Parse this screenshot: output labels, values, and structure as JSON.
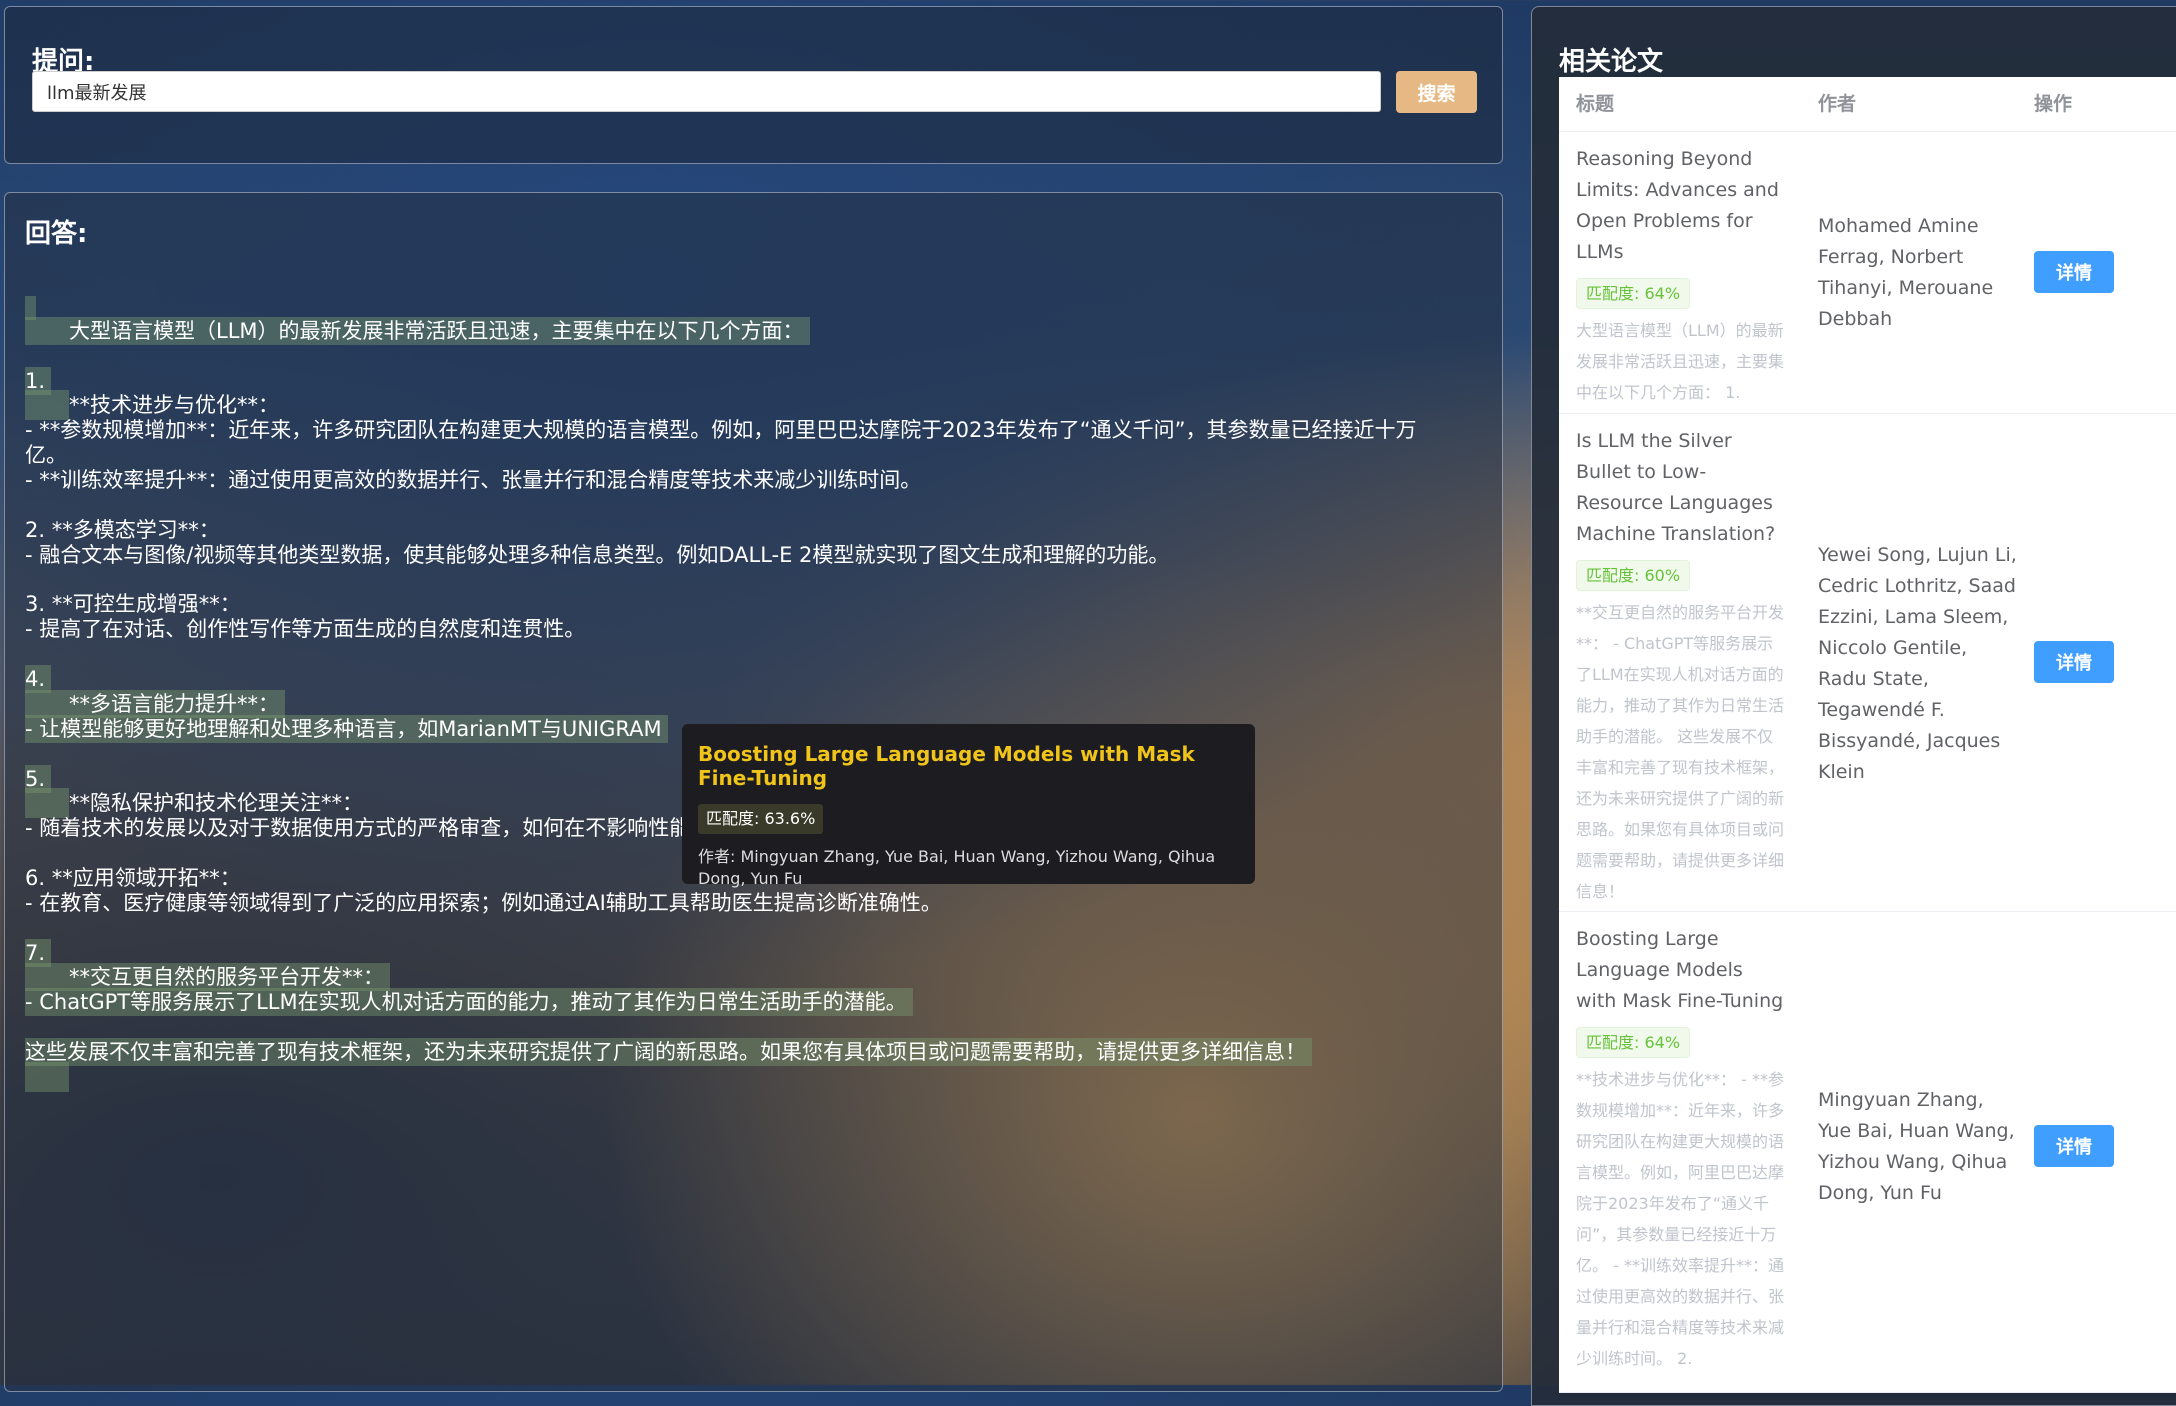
{
  "ask": {
    "title": "提问:",
    "query": "llm最新发展",
    "search_label": "搜索"
  },
  "answer": {
    "title": "回答:",
    "lines": [
      "大型语言模型（LLM）的最新发展非常活跃且迅速，主要集中在以下几个方面：",
      "1.",
      "**技术进步与优化**：",
      " - **参数规模增加**：近年来，许多研究团队在构建更大规模的语言模型。例如，阿里巴巴达摩院于2023年发布了“通义千问”，其参数量已经接近十万",
      "亿。",
      " - **训练效率提升**：通过使用更高效的数据并行、张量并行和混合精度等技术来减少训练时间。",
      "2. **多模态学习**：",
      " - 融合文本与图像/视频等其他类型数据，使其能够处理多种信息类型。例如DALL-E 2模型就实现了图文生成和理解的功能。",
      "3. **可控生成增强**：",
      " - 提高了在对话、创作性写作等方面生成的自然度和连贯性。",
      "4.",
      "**多语言能力提升**：",
      " - 让模型能够更好地理解和处理多种语言，如MarianMT与UNIGRAM",
      "5.",
      "**隐私保护和技术伦理关注**：",
      " - 随着技术的发展以及对于数据使用方式的严格审查，如何在不影响性能的情况下保护用户隐私成为一个重要研究方向。",
      "6. **应用领域开拓**：",
      " - 在教育、医疗健康等领域得到了广泛的应用探索；例如通过AI辅助工具帮助医生提高诊断准确性。",
      "7.",
      "**交互更自然的服务平台开发**：",
      " - ChatGPT等服务展示了LLM在实现人机对话方面的能力，推动了其作为日常生活助手的潜能。",
      "这些发展不仅丰富和完善了现有技术框架，还为未来研究提供了广阔的新思路。如果您有具体项目或问题需要帮助，请提供更多详细信息！"
    ]
  },
  "papers": {
    "title": "相关论文",
    "columns": [
      "标题",
      "作者",
      "操作"
    ],
    "detail_label": "详情",
    "rows": [
      {
        "title": "Reasoning Beyond Limits: Advances and Open Problems for LLMs",
        "match": "匹配度: 64%",
        "snippet": "大型语言模型（LLM）的最新发展非常活跃且迅速，主要集中在以下几个方面： 1.",
        "authors": "Mohamed Amine Ferrag, Norbert Tihanyi, Merouane Debbah"
      },
      {
        "title": "Is LLM the Silver Bullet to Low-Resource Languages Machine Translation?",
        "match": "匹配度: 60%",
        "snippet": "**交互更自然的服务平台开发**： - ChatGPT等服务展示了LLM在实现人机对话方面的能力，推动了其作为日常生活助手的潜能。 这些发展不仅丰富和完善了现有技术框架，还为未来研究提供了广阔的新思路。如果您有具体项目或问题需要帮助，请提供更多详细信息！",
        "authors": "Yewei Song, Lujun Li, Cedric Lothritz, Saad Ezzini, Lama Sleem, Niccolo Gentile, Radu State, Tegawendé F. Bissyandé, Jacques Klein"
      },
      {
        "title": "Boosting Large Language Models with Mask Fine-Tuning",
        "match": "匹配度: 64%",
        "snippet": "**技术进步与优化**： - **参数规模增加**：近年来，许多研究团队在构建更大规模的语言模型。例如，阿里巴巴达摩院于2023年发布了“通义千问”，其参数量已经接近十万亿。 - **训练效率提升**：通过使用更高效的数据并行、张量并行和混合精度等技术来减少训练时间。 2.",
        "authors": "Mingyuan Zhang, Yue Bai, Huan Wang, Yizhou Wang, Qihua Dong, Yun Fu"
      }
    ]
  },
  "tooltip": {
    "title": "Boosting Large Language Models with Mask Fine-Tuning",
    "match": "匹配度: 63.6%",
    "authors": "作者: Mingyuan Zhang, Yue Bai, Huan Wang, Yizhou Wang, Qihua Dong, Yun Fu"
  }
}
